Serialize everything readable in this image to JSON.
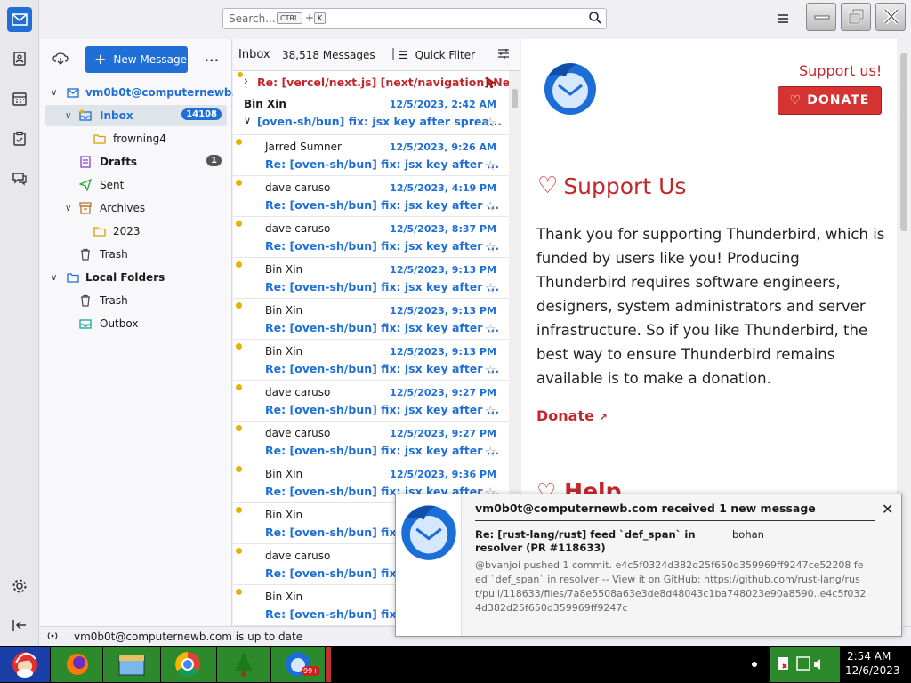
{
  "search": {
    "placeholder": "Search...",
    "key1": "CTRL",
    "plus": "+",
    "key2": "K"
  },
  "folders": {
    "new_message": "New Message",
    "more": "...",
    "items": [
      {
        "label": "vm0b0t@computernewb...",
        "badge": ""
      },
      {
        "label": "Inbox",
        "badge": "14108"
      },
      {
        "label": "frowning4",
        "badge": ""
      },
      {
        "label": "Drafts",
        "badge": "1"
      },
      {
        "label": "Sent",
        "badge": ""
      },
      {
        "label": "Archives",
        "badge": ""
      },
      {
        "label": "2023",
        "badge": ""
      },
      {
        "label": "Trash",
        "badge": ""
      },
      {
        "label": "Local Folders",
        "badge": ""
      },
      {
        "label": "Trash",
        "badge": ""
      },
      {
        "label": "Outbox",
        "badge": ""
      }
    ]
  },
  "thread": {
    "title": "Inbox",
    "count": "38,518 Messages",
    "quick_filter": "Quick Filter",
    "first_row": "Re: [vercel/next.js] [next/navigation] Ne...",
    "group": {
      "from": "Bin Xin",
      "date": "12/5/2023, 2:42 AM",
      "subject": "[oven-sh/bun] fix: jsx key after sprea..."
    },
    "rows": [
      {
        "from": "Jarred Sumner",
        "date": "12/5/2023, 9:26 AM",
        "subject": "Re: [oven-sh/bun] fix: jsx key after ..."
      },
      {
        "from": "dave caruso",
        "date": "12/5/2023, 4:19 PM",
        "subject": "Re: [oven-sh/bun] fix: jsx key after ..."
      },
      {
        "from": "dave caruso",
        "date": "12/5/2023, 8:37 PM",
        "subject": "Re: [oven-sh/bun] fix: jsx key after ..."
      },
      {
        "from": "Bin Xin",
        "date": "12/5/2023, 9:13 PM",
        "subject": "Re: [oven-sh/bun] fix: jsx key after ..."
      },
      {
        "from": "Bin Xin",
        "date": "12/5/2023, 9:13 PM",
        "subject": "Re: [oven-sh/bun] fix: jsx key after ..."
      },
      {
        "from": "Bin Xin",
        "date": "12/5/2023, 9:13 PM",
        "subject": "Re: [oven-sh/bun] fix: jsx key after ..."
      },
      {
        "from": "dave caruso",
        "date": "12/5/2023, 9:27 PM",
        "subject": "Re: [oven-sh/bun] fix: jsx key after ..."
      },
      {
        "from": "dave caruso",
        "date": "12/5/2023, 9:27 PM",
        "subject": "Re: [oven-sh/bun] fix: jsx key after ..."
      },
      {
        "from": "Bin Xin",
        "date": "12/5/2023, 9:36 PM",
        "subject": "Re: [oven-sh/bun] fix: jsx key after ..."
      },
      {
        "from": "Bin Xin",
        "date": "",
        "subject": "Re: [oven-sh/bun] fix: js"
      },
      {
        "from": "dave caruso",
        "date": "",
        "subject": "Re: [oven-sh/bun] fix: js"
      },
      {
        "from": "Bin Xin",
        "date": "",
        "subject": "Re: [oven-sh/bun] fix: js"
      }
    ]
  },
  "preview": {
    "support_top": "Support us!",
    "donate_button": "DONATE",
    "support_title": "Support Us",
    "support_body": "Thank you for supporting Thunderbird, which is funded by users like you! Producing Thunderbird requires software engineers, designers, system administrators and server infrastructure. So if you like Thunderbird, the best way to ensure Thunderbird remains available is to make a donation.",
    "donate_link": "Donate",
    "help_partial": "Help"
  },
  "status": {
    "text": "vm0b0t@computernewb.com is up to date"
  },
  "notification": {
    "title": "vm0b0t@computernewb.com received 1 new message",
    "subject": "Re: [rust-lang/rust] feed `def_span` in resolver (PR #118633)",
    "sender": "bohan",
    "body": "@bvanjoi pushed 1 commit. e4c5f0324d382d25f650d359969ff9247ce52208 feed `def_span` in resolver -- View it on GitHub: https://github.com/rust-lang/rust/pull/118633/files/7a8e5508a63e3de8d48043c1ba748023e90a8590..e4c5f0324d382d25f650d359969ff9247c"
  },
  "taskbar": {
    "time": "2:54 AM",
    "date": "12/6/2023",
    "badge": "99+"
  },
  "colors": {
    "accent": "#1f6fd6",
    "support_red": "#c2272c",
    "unread_dot": "#e4b200"
  }
}
